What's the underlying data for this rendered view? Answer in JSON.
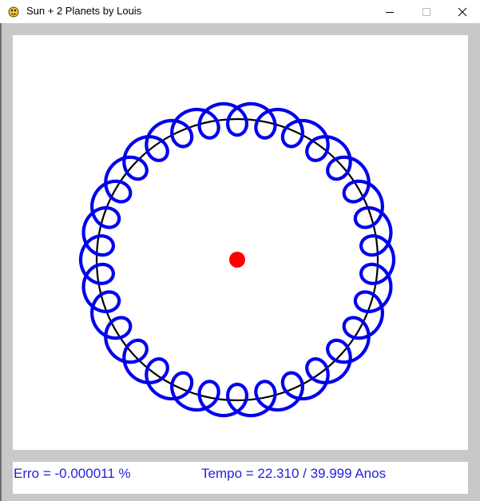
{
  "window": {
    "title": "Sun + 2 Planets by Louis",
    "app_icon": "pygame-snake-icon",
    "controls": {
      "minimize_icon": "minimize-icon",
      "maximize_icon": "maximize-icon",
      "close_icon": "close-icon"
    }
  },
  "simulation": {
    "sun_color": "#ff0000",
    "orbit_color": "#000000",
    "moon_trail_color": "#0000ee",
    "loops_per_orbit": 31
  },
  "status": {
    "erro": "Erro = -0.000011 %",
    "tempo": "Tempo = 22.310 / 39.999 Anos",
    "text_color": "#2222dd"
  }
}
